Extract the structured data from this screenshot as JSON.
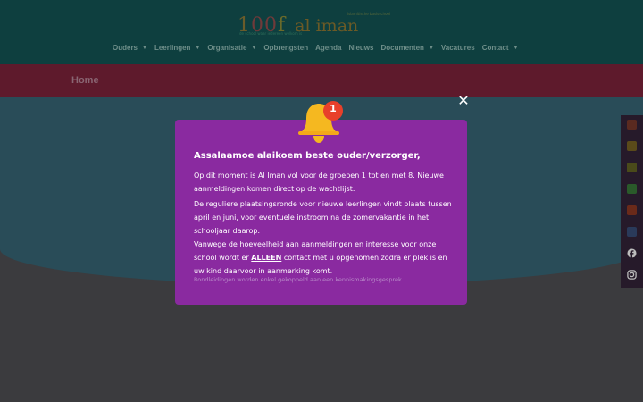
{
  "header": {
    "logo_text_1": "1",
    "logo_text_2": "00",
    "logo_text_3": "f",
    "logo_brand": "al iman",
    "logo_tagline": "islamitische basisschool",
    "logo_subtitle": "de school waar iedereen welkom is"
  },
  "nav": {
    "items": [
      {
        "label": "Ouders",
        "has_dropdown": true
      },
      {
        "label": "Leerlingen",
        "has_dropdown": true
      },
      {
        "label": "Organisatie",
        "has_dropdown": true
      },
      {
        "label": "Opbrengsten",
        "has_dropdown": false
      },
      {
        "label": "Agenda",
        "has_dropdown": false
      },
      {
        "label": "Nieuws",
        "has_dropdown": false
      },
      {
        "label": "Documenten",
        "has_dropdown": true
      },
      {
        "label": "Vacatures",
        "has_dropdown": false
      },
      {
        "label": "Contact",
        "has_dropdown": true
      }
    ]
  },
  "pagebar": {
    "title": "Home"
  },
  "popup": {
    "close_label": "✕",
    "badge_count": "1",
    "title": "Assalaamoe alaikoem beste ouder/verzorger,",
    "paragraph_1": "Op dit moment is Al Iman vol voor de groepen 1 tot en met 8. Nieuwe aanmeldingen komen direct op de wachtlijst.",
    "paragraph_2": "De reguliere plaatsingsronde voor nieuwe leerlingen vindt plaats tussen april en juni, voor eventuele instroom na de zomervakantie in het schooljaar daarop.",
    "paragraph_3_before": "Vanwege de hoeveelheid aan aanmeldingen en interesse voor onze school wordt er ",
    "paragraph_3_strong": "ALLEEN",
    "paragraph_3_after": " contact met u opgenomen zodra er plek is en uw kind daarvoor in aanmerking komt.",
    "paragraph_4": "Rondleidingen worden enkel gekoppeld aan een kennismakingsgesprek."
  },
  "side_icons": [
    {
      "name": "accessibility-icon",
      "color": "#7a3020"
    },
    {
      "name": "flower-icon",
      "color": "#6a5a1a"
    },
    {
      "name": "sun-icon",
      "color": "#6a5a1a"
    },
    {
      "name": "book-icon",
      "color": "#2a6a2a"
    },
    {
      "name": "apple-icon",
      "color": "#7a3020"
    },
    {
      "name": "building-icon",
      "color": "#2a4a7a"
    },
    {
      "name": "facebook-icon",
      "color": "#cfcfcf"
    },
    {
      "name": "instagram-icon",
      "color": "#cfcfcf"
    }
  ],
  "colors": {
    "modal_bg": "#8a2aa0",
    "bell_color": "#f5b820",
    "badge_color": "#e8402a"
  }
}
